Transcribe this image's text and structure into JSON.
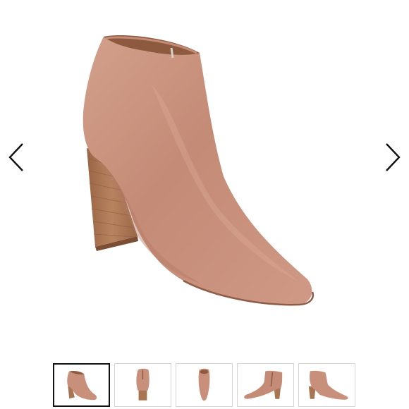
{
  "gallery": {
    "product_image": "suede-pointed-toe-ankle-bootie",
    "prev_icon": "chevron-left-icon",
    "next_icon": "chevron-right-icon",
    "selected_index": 0,
    "thumbnails": [
      {
        "view": "three-quarter",
        "selected": true
      },
      {
        "view": "back",
        "selected": false
      },
      {
        "view": "top",
        "selected": false
      },
      {
        "view": "side-zipper",
        "selected": false
      },
      {
        "view": "side",
        "selected": false
      }
    ]
  },
  "colors": {
    "suede": "#c8907b",
    "suede_shadow": "#b37a66",
    "suede_light": "#d9a996",
    "lining": "#8d5a3f",
    "heel_wood": "#a97451",
    "heel_stripe": "#8a5a3c",
    "arrow": "#111111",
    "thumb_border": "#d4d4d4",
    "thumb_selected_border": "#111111"
  }
}
